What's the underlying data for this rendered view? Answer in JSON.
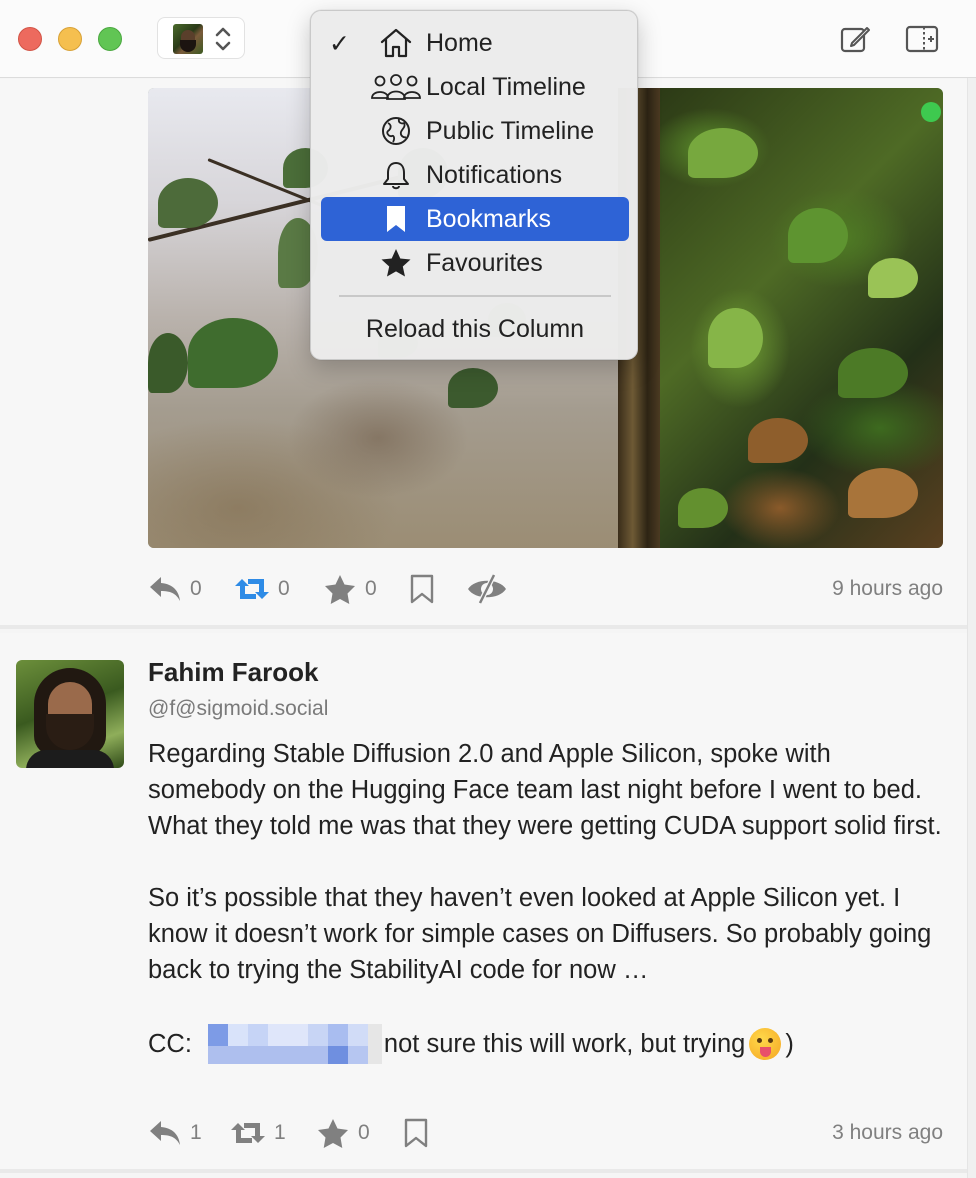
{
  "toolbar": {
    "account_switcher": {
      "avatar": "user-avatar",
      "chevron_icon": "up-down-chevron-icon"
    },
    "compose_icon": "compose-icon",
    "sidebar_icon": "sidebar-toggle-icon"
  },
  "menu": {
    "items": [
      {
        "label": "Home",
        "icon": "house-icon",
        "checked": true,
        "selected": false
      },
      {
        "label": "Local Timeline",
        "icon": "people-icon",
        "checked": false,
        "selected": false
      },
      {
        "label": "Public Timeline",
        "icon": "globe-icon",
        "checked": false,
        "selected": false
      },
      {
        "label": "Notifications",
        "icon": "bell-icon",
        "checked": false,
        "selected": false
      },
      {
        "label": "Bookmarks",
        "icon": "bookmark-icon",
        "checked": false,
        "selected": true
      },
      {
        "label": "Favourites",
        "icon": "star-icon",
        "checked": false,
        "selected": false
      }
    ],
    "reload_label": "Reload this Column",
    "check_mark": "✓"
  },
  "post1": {
    "media": "image-photo",
    "online_indicator_color": "#3ec94f",
    "actions": {
      "reply_count": "0",
      "boost_count": "0",
      "favourite_count": "0",
      "boost_color": "#2e8be6"
    },
    "timestamp": "9 hours ago"
  },
  "post2": {
    "author_name": "Fahim Farook",
    "author_handle": "@f@sigmoid.social",
    "paragraphs": [
      "Regarding Stable Diffusion 2.0 and Apple Silicon, spoke with somebody on the Hugging Face team last night before I went to bed. What they told me was that they were getting CUDA support solid first.",
      "So it’s possible that they haven’t even looked at Apple Silicon yet. I know it doesn’t work for simple cases on Diffusers. So probably going back to trying the StabilityAI code for now …"
    ],
    "cc_prefix": "CC:",
    "cc_suffix": "not sure this will work, but trying",
    "cc_close": ")",
    "actions": {
      "reply_count": "1",
      "boost_count": "1",
      "favourite_count": "0"
    },
    "timestamp": "3 hours ago"
  },
  "colors": {
    "accent": "#2e63d6",
    "icon_gray": "#808080"
  }
}
